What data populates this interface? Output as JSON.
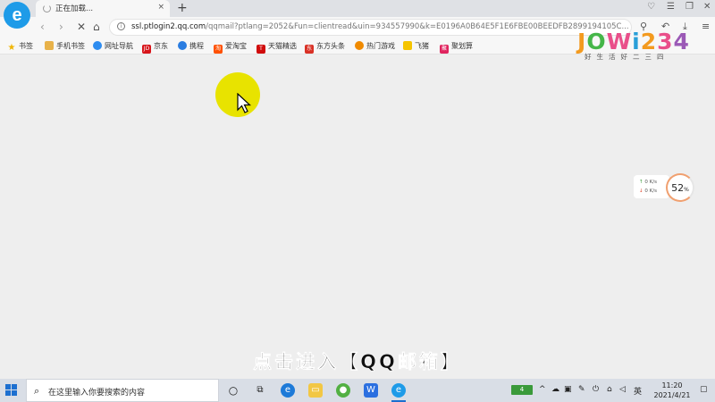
{
  "browser": {
    "tab_title": "正在加载...",
    "tab_close": "×",
    "new_tab": "+",
    "url_domain": "ssl.ptlogin2.qq.com",
    "url_rest": "/qqmail?ptlang=2052&Fun=clientread&uin=934557990&k=E0196A0B64E5F1E6FBE00BEEDFB2899194105C..."
  },
  "bookmarks": [
    {
      "label": "书签",
      "icon": "star-icon",
      "color": "#f0b400"
    },
    {
      "label": "手机书签",
      "icon": "folder-icon",
      "color": "#e8b24a"
    },
    {
      "label": "网址导航",
      "icon": "compass-icon",
      "color": "#2d8cf0"
    },
    {
      "label": "京东",
      "icon": "jd-icon",
      "color": "#d7141a",
      "glyph": "JD"
    },
    {
      "label": "携程",
      "icon": "ctrip-icon",
      "color": "#2a7de1"
    },
    {
      "label": "爱淘宝",
      "icon": "taobao-icon",
      "color": "#ff5000",
      "glyph": "淘"
    },
    {
      "label": "天猫精选",
      "icon": "tmall-icon",
      "color": "#d00c0c",
      "glyph": "T"
    },
    {
      "label": "东方头条",
      "icon": "toutiao-icon",
      "color": "#d93025",
      "glyph": "东"
    },
    {
      "label": "热门游戏",
      "icon": "games-icon",
      "color": "#f08a00"
    },
    {
      "label": "飞猪",
      "icon": "fliggy-icon",
      "color": "#f5c400"
    },
    {
      "label": "聚划算",
      "icon": "juhuasuan-icon",
      "color": "#e0245e",
      "glyph": "聚"
    }
  ],
  "watermark": {
    "brand": "JOWi234",
    "tagline": "好生活好二三四"
  },
  "net_speed": {
    "up": "0",
    "down": "0",
    "unit": "K/s",
    "percent": "52",
    "percent_unit": "%"
  },
  "caption": "点击进入【QQ邮箱】",
  "taskbar": {
    "search_placeholder": "在这里输入你要搜索的内容",
    "battery": "4",
    "ime": "英",
    "time": "11:20",
    "date": "2021/4/21"
  }
}
